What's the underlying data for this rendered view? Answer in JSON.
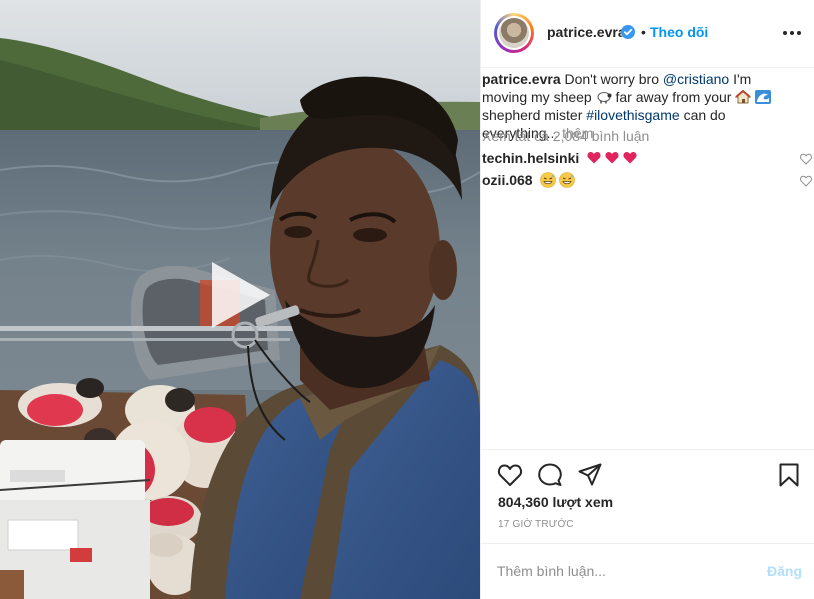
{
  "header": {
    "username": "patrice.evra",
    "separator": "•",
    "follow_label": "Theo dõi"
  },
  "caption": {
    "username": "patrice.evra",
    "text_1": "Don't worry bro",
    "mention": "@cristiano",
    "text_2": "I'm moving my sheep",
    "text_3": "far away from your",
    "text_4": "shepherd mister",
    "hashtag": "#ilovethisgame",
    "text_5": "can do everything...",
    "more_label": "thêm"
  },
  "view_all_comments": "Xem tất cả 2,084 bình luận",
  "comments": [
    {
      "username": "techin.helsinki",
      "emoji": [
        "red-heart",
        "red-heart",
        "red-heart"
      ]
    },
    {
      "username": "ozii.068",
      "emoji": [
        "grinning-sweat",
        "grinning-sweat"
      ]
    }
  ],
  "stats": {
    "views": "804,360 lượt xem",
    "time": "17 GIỜ TRƯỚC"
  },
  "add_comment": {
    "placeholder": "Thêm bình luận...",
    "post_label": "Đăng"
  },
  "icons": {
    "verified": "verified-badge-icon",
    "more": "more-options-icon",
    "like": "heart-outline-icon",
    "comment": "comment-bubble-icon",
    "share": "paper-plane-icon",
    "save": "bookmark-icon",
    "play": "play-icon"
  },
  "colors": {
    "accent": "#0095f6",
    "link": "#00376b",
    "muted": "#8e8e8e",
    "post_disabled": "#b2dffc",
    "heart": "#ed4956"
  }
}
